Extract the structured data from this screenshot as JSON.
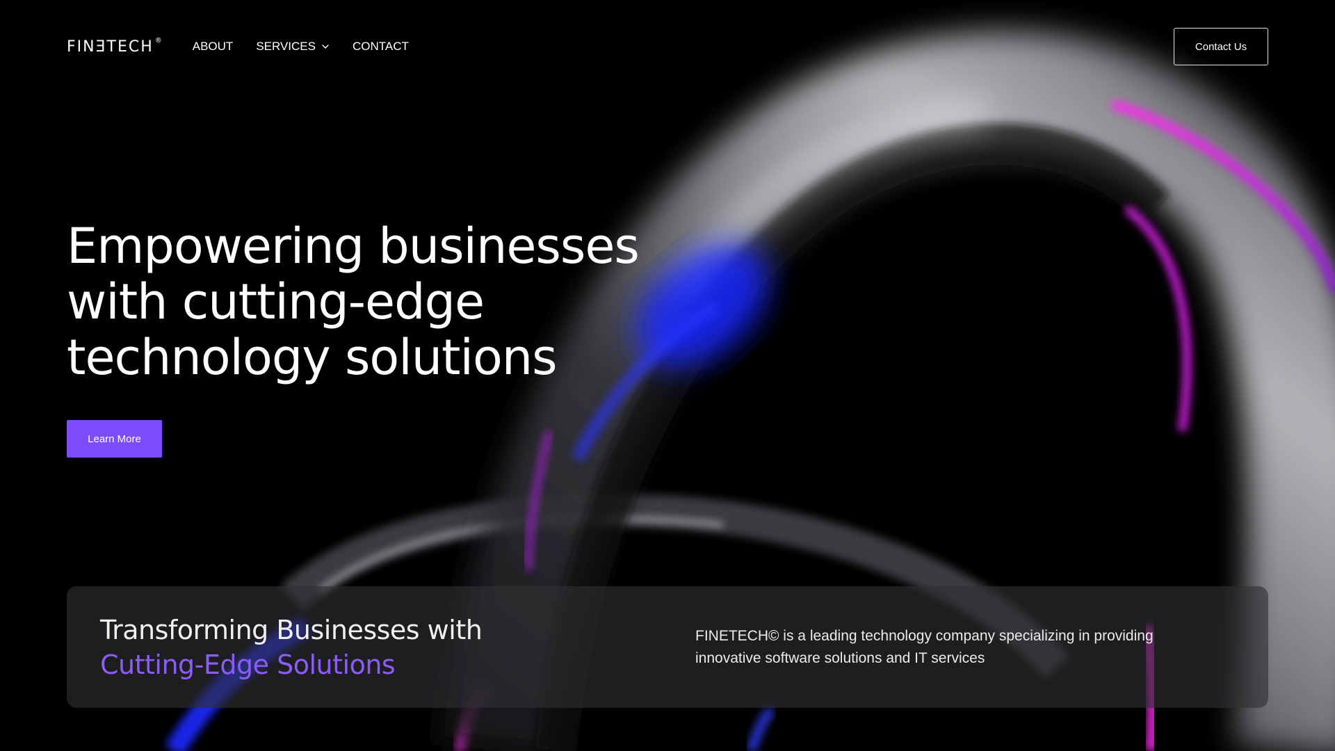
{
  "brand": {
    "logo_text": "FINƎTECH",
    "logo_mark": "®"
  },
  "nav": {
    "items": [
      {
        "label": "ABOUT"
      },
      {
        "label": "SERVICES",
        "icon": "chevron-down-icon"
      },
      {
        "label": "CONTACT"
      }
    ],
    "contact_button": "Contact Us"
  },
  "hero": {
    "title_lines": [
      "Empowering businesses",
      "with cutting-edge",
      "technology solutions"
    ],
    "cta_label": "Learn More"
  },
  "info_card": {
    "heading_line1": "Transforming Businesses with",
    "heading_line2": "Cutting-Edge Solutions",
    "description": "FINETECH© is a leading technology company specializing in providing innovative software solutions and IT services"
  },
  "colors": {
    "background": "#000000",
    "accent": "#7c4dff",
    "accent_text": "#8b5cf6",
    "card_background": "#303034"
  }
}
